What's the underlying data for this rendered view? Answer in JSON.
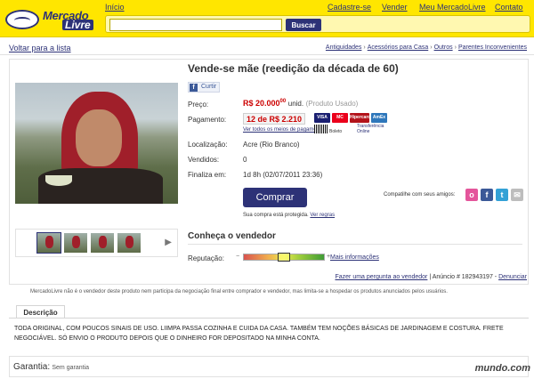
{
  "header": {
    "logo": {
      "line1": "Mercado",
      "line2": "Livre"
    },
    "links": [
      "Início",
      "Cadastre-se",
      "Vender",
      "Meu MercadoLivre",
      "Contato"
    ],
    "search": {
      "value": "",
      "button_label": "Buscar"
    }
  },
  "breadcrumb": {
    "back_label": "Voltar para a lista",
    "items": [
      "Antiguidades",
      "Acessórios para Casa",
      "Outros",
      "Parentes Inconvenientes"
    ]
  },
  "product": {
    "title": "Vende-se mãe (reedição da década de 60)",
    "like_label": "Curtir",
    "price_label": "Preço:",
    "price": "R$ 20.000",
    "price_cents": "00",
    "price_unit": "unid.",
    "price_condition": "(Produto Usado)",
    "payment_label": "Pagamento:",
    "installment": "12 de R$ 2.210",
    "payment_link": "Ver todos os meios de pagamento",
    "cards": [
      {
        "name": "VISA",
        "color": "#1a1f71"
      },
      {
        "name": "MC",
        "color": "#eb001b"
      },
      {
        "name": "Hipercard",
        "color": "#b3131b"
      },
      {
        "name": "AmEx",
        "color": "#2e77bb"
      }
    ],
    "boleto_label": "Boleto",
    "transfer_label": "Transferência Online",
    "location_label": "Localização:",
    "location": "Acre (Rio Branco)",
    "sold_label": "Vendidos:",
    "sold": "0",
    "ends_label": "Finaliza em:",
    "ends": "1d 8h (02/07/2011 23:36)",
    "buy_label": "Comprar",
    "protect_text": "Sua compra está protegida.",
    "protect_link": "Ver regras",
    "share_label": "Compatilhe com seus amigos:",
    "share_icons": [
      {
        "name": "orkut-icon",
        "glyph": "o",
        "color": "#e4559b"
      },
      {
        "name": "facebook-icon",
        "glyph": "f",
        "color": "#3b5998"
      },
      {
        "name": "twitter-icon",
        "glyph": "t",
        "color": "#33a1d6"
      },
      {
        "name": "email-icon",
        "glyph": "✉",
        "color": "#bdbdbd"
      }
    ]
  },
  "seller": {
    "title": "Conheça o vendedor",
    "reputation_label": "Reputação:",
    "reputation_level": 0.5,
    "minus": "−",
    "plus": "+",
    "more_info": "Mais informações"
  },
  "footer": {
    "ask_link": "Fazer uma pergunta ao vendedor",
    "listing_id": "| Anúncio # 182943197 -",
    "report_link": "Denunciar",
    "disclaimer": "MercadoLivre não é o vendedor deste produto nem participa da negociação final entre comprador e vendedor, mas limita-se a hospedar os produtos anunciados pelos usuários.",
    "desc_tab": "Descrição",
    "description": "TODA ORIGINAL, COM POUCOS SINAIS DE USO. LIIMPA PASSA COZINHA E CUIDA DA CASA. TAMBÉM TEM NOÇÕES BÁSICAS DE JARDINAGEM E COSTURA. FRETE NEGOCIÁVEL. SÓ ENVIO O PRODUTO DEPOIS QUE O DINHEIRO FOR DEPOSITADO NA MINHA CONTA.",
    "warranty_label": "Garantia:",
    "warranty_value": "Sem garantia",
    "watermark": "mundo.com"
  }
}
